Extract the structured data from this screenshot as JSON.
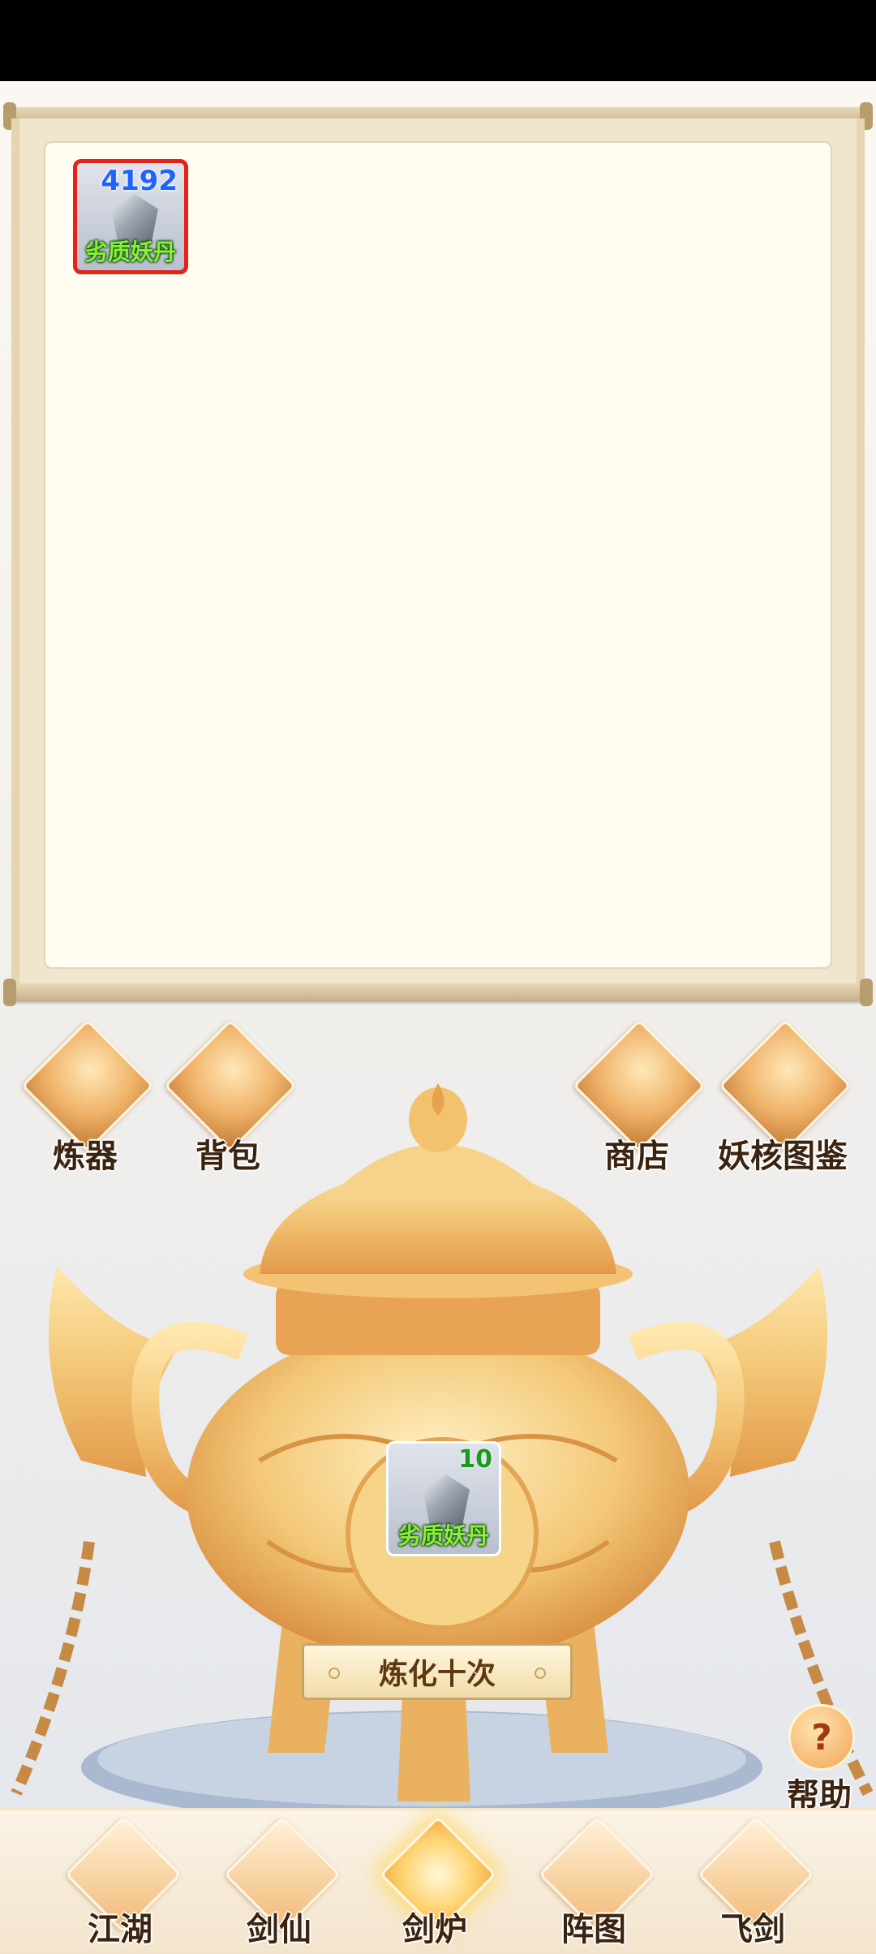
{
  "inventory": {
    "item": {
      "name": "劣质妖丹",
      "count": "4192",
      "icon": "gem-icon"
    }
  },
  "side_buttons": {
    "refine": "炼器",
    "backpack": "背包",
    "shop": "商店",
    "codex": "妖核图鉴"
  },
  "cauldron": {
    "slot_item": {
      "name": "劣质妖丹",
      "count": "10"
    },
    "action_label": "炼化十次"
  },
  "help_label": "帮助",
  "bottom_nav": {
    "items": [
      "江湖",
      "剑仙",
      "剑炉",
      "阵图",
      "飞剑"
    ],
    "active": "剑炉"
  },
  "colors": {
    "gold": "#f0b36a",
    "item_text": "#8aef3a",
    "count_blue": "#1e63ff",
    "count_green": "#1a9a1a",
    "selected_border": "#e3221c"
  }
}
